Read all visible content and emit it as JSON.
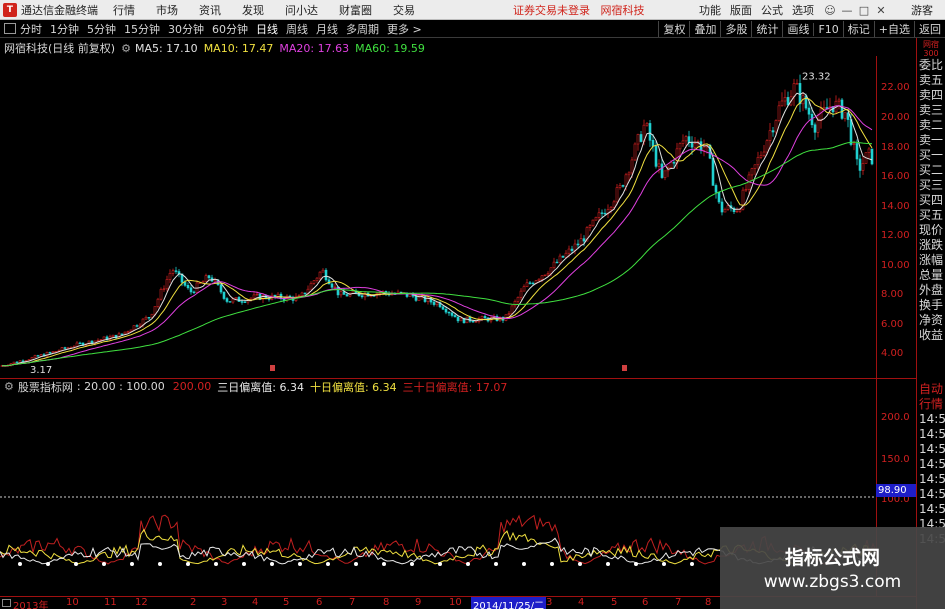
{
  "titlebar": {
    "app_title": "通达信金融终端",
    "menu": [
      "行情",
      "市场",
      "资讯",
      "发现",
      "问小达",
      "财富圈",
      "交易"
    ],
    "notice": "证券交易未登录",
    "stock_name": "网宿科技",
    "right_menu": [
      "功能",
      "版面",
      "公式",
      "选项"
    ],
    "guest": "游客"
  },
  "toolbar": {
    "periods": [
      "分时",
      "1分钟",
      "5分钟",
      "15分钟",
      "30分钟",
      "60分钟",
      "日线",
      "周线",
      "月线",
      "多周期",
      "更多 >"
    ],
    "active_period": "日线",
    "right_tools": [
      "复权",
      "叠加",
      "多股",
      "统计",
      "画线",
      "F10",
      "标记",
      "+自选",
      "返回"
    ]
  },
  "kline_header": {
    "stock": "网宿科技(日线 前复权)",
    "ma5": "MA5: 17.10",
    "ma10": "MA10: 17.47",
    "ma20": "MA20: 17.63",
    "ma60": "MA60: 19.59"
  },
  "main_axis": {
    "ticks": [
      "22.00",
      "20.00",
      "18.00",
      "16.00",
      "14.00",
      "12.00",
      "10.00",
      "8.00",
      "6.00",
      "4.00"
    ],
    "high_label": "23.32",
    "low_label": "3.17"
  },
  "indicator_header": {
    "name": "股票指标网",
    "param1": ": 20.00 : 100.00",
    "param2": "200.00",
    "line1": "三日偏离值: 6.34",
    "line2": "十日偏离值: 6.34",
    "line3": "三十日偏离值: 17.07"
  },
  "indicator_axis": {
    "ticks": [
      "200.0",
      "150.0",
      "100.0"
    ],
    "highlight": "98.90"
  },
  "timeline": {
    "labels": [
      "2013年",
      "10",
      "11",
      "12",
      "2",
      "3",
      "4",
      "5",
      "6",
      "7",
      "8",
      "9",
      "10",
      "11",
      "2014/11/25/二",
      "3",
      "4",
      "5",
      "6",
      "7",
      "8"
    ],
    "cursor_label": "2014/11/25/二"
  },
  "right_panel": {
    "code": "网宿 300",
    "quote_items": [
      "委比",
      "卖五",
      "卖四",
      "卖三",
      "卖二",
      "卖一",
      "买一",
      "买二",
      "买三",
      "买四",
      "买五",
      "现价",
      "涨跌",
      "涨幅",
      "总量",
      "外盘",
      "换手",
      "净资",
      "收益"
    ],
    "lower_items": [
      "自动",
      "行情",
      "14:50",
      "14:50",
      "14:50",
      "14:50",
      "14:50",
      "14:50",
      "14:50",
      "14:50",
      "14:50"
    ]
  },
  "watermark": {
    "title": "指标公式网",
    "url": "www.zbgs3.com"
  },
  "colors": {
    "up": "#d02020",
    "down": "#20d0d0",
    "ma5": "#e0e0e0",
    "ma10": "#f0e040",
    "ma20": "#e040e0",
    "ma60": "#40e040",
    "axis": "#a01010"
  }
}
